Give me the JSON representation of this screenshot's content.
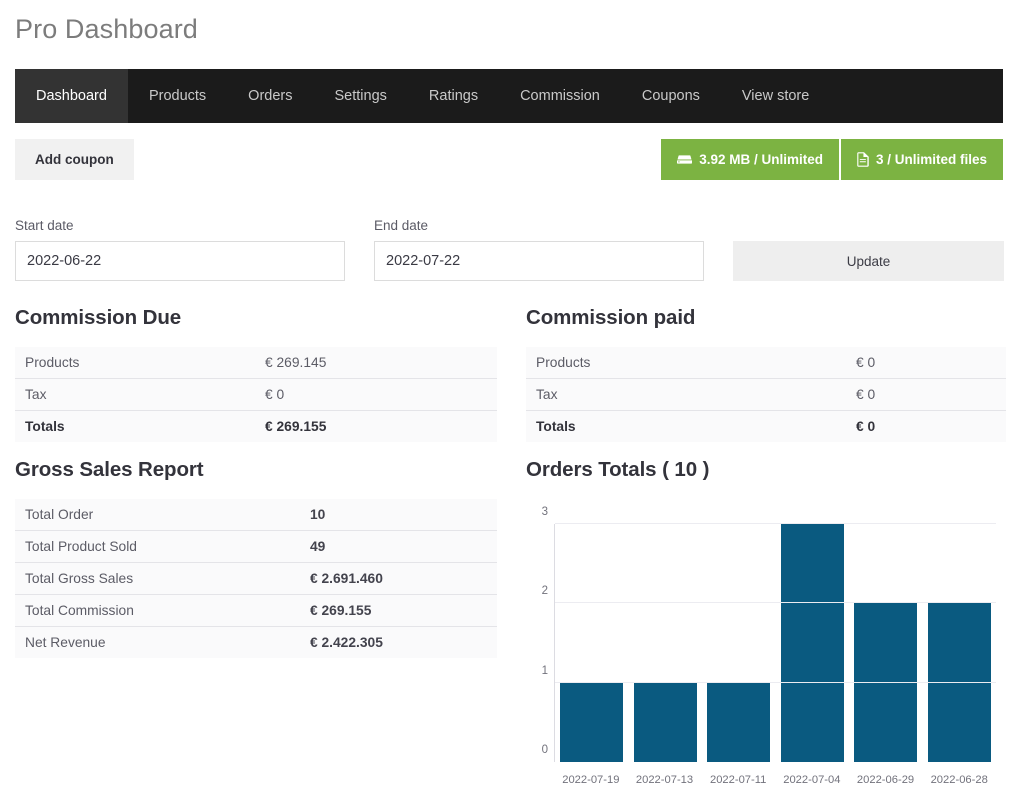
{
  "header": {
    "title": "Pro Dashboard"
  },
  "nav": {
    "items": [
      {
        "label": "Dashboard",
        "active": true
      },
      {
        "label": "Products",
        "active": false
      },
      {
        "label": "Orders",
        "active": false
      },
      {
        "label": "Settings",
        "active": false
      },
      {
        "label": "Ratings",
        "active": false
      },
      {
        "label": "Commission",
        "active": false
      },
      {
        "label": "Coupons",
        "active": false
      },
      {
        "label": "View store",
        "active": false
      }
    ]
  },
  "actions": {
    "add_coupon_label": "Add coupon",
    "badges": [
      {
        "icon": "hard-drive-icon",
        "label": "3.92 MB / Unlimited",
        "color": "#7cb342"
      },
      {
        "icon": "file-icon",
        "label": "3 / Unlimited files",
        "color": "#7cb342"
      }
    ]
  },
  "filters": {
    "start_label": "Start date",
    "start_value": "2022-06-22",
    "start_placeholder": "Start date",
    "end_label": "End date",
    "end_value": "2022-07-22",
    "end_placeholder": "End date",
    "update_label": "Update"
  },
  "commission_due": {
    "title": "Commission Due",
    "rows": [
      {
        "key": "Products",
        "value": "€ 269.145",
        "total": false
      },
      {
        "key": "Tax",
        "value": "€ 0",
        "total": false
      },
      {
        "key": "Totals",
        "value": "€ 269.155",
        "total": true
      }
    ]
  },
  "commission_paid": {
    "title": "Commission paid",
    "rows": [
      {
        "key": "Products",
        "value": "€ 0",
        "total": false
      },
      {
        "key": "Tax",
        "value": "€ 0",
        "total": false
      },
      {
        "key": "Totals",
        "value": "€ 0",
        "total": true
      }
    ]
  },
  "gross_sales": {
    "title": "Gross Sales Report",
    "rows": [
      {
        "key": "Total Order",
        "value": "10"
      },
      {
        "key": "Total Product Sold",
        "value": "49"
      },
      {
        "key": "Total Gross Sales",
        "value": "€ 2.691.460"
      },
      {
        "key": "Total Commission",
        "value": "€ 269.155"
      },
      {
        "key": "Net Revenue",
        "value": "€ 2.422.305"
      }
    ]
  },
  "orders_totals": {
    "title": "Orders Totals ( 10 )"
  },
  "chart_data": {
    "type": "bar",
    "title": "Orders Totals ( 10 )",
    "categories": [
      "2022-07-19",
      "2022-07-13",
      "2022-07-11",
      "2022-07-04",
      "2022-06-29",
      "2022-06-28"
    ],
    "values": [
      1,
      1,
      1,
      3,
      2,
      2
    ],
    "xlabel": "",
    "ylabel": "",
    "ylim": [
      0,
      3
    ],
    "yticks": [
      0,
      1,
      2,
      3
    ],
    "grid": true,
    "legend": false,
    "bar_color": "#0a5a80"
  }
}
